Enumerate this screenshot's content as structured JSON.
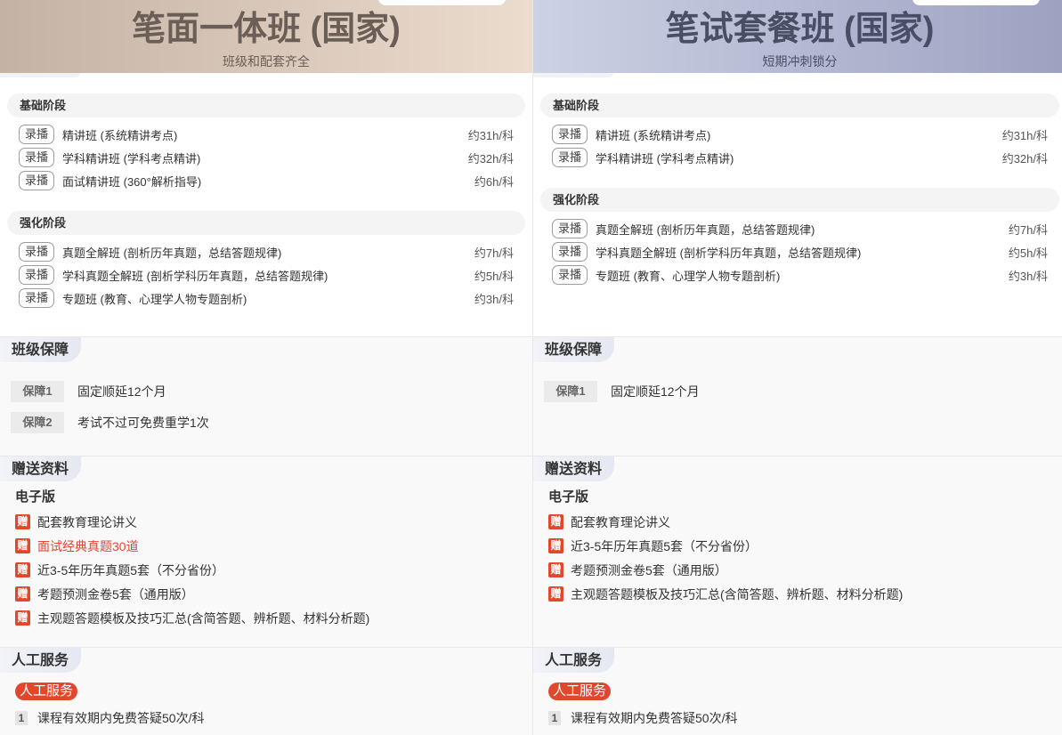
{
  "colors": {
    "accent": "#e0482d",
    "left_header_from": "#c4b3a5",
    "left_header_to": "#ecdccd",
    "left_title": "#6b5e57",
    "right_header_from": "#cdd1e4",
    "right_header_to": "#9da2c1",
    "right_title": "#4a4e65"
  },
  "columns": [
    {
      "title": "笔面一体班 (国家)",
      "subtitle": "班级和配套齐全",
      "stages": [
        {
          "name": "基础阶段",
          "items": [
            {
              "tag": "录播",
              "name": "精讲班 (系统精讲考点)",
              "duration": "约31h/科"
            },
            {
              "tag": "录播",
              "name": "学科精讲班 (学科考点精讲)",
              "duration": "约32h/科"
            },
            {
              "tag": "录播",
              "name": "面试精讲班 (360°解析指导)",
              "duration": "约6h/科"
            }
          ]
        },
        {
          "name": "强化阶段",
          "items": [
            {
              "tag": "录播",
              "name": "真题全解班 (剖析历年真题，总结答题规律)",
              "duration": "约7h/科"
            },
            {
              "tag": "录播",
              "name": "学科真题全解班 (剖析学科历年真题，总结答题规律)",
              "duration": "约5h/科"
            },
            {
              "tag": "录播",
              "name": "专题班 (教育、心理学人物专题剖析)",
              "duration": "约3h/科"
            }
          ]
        }
      ],
      "guarantee": {
        "title": "班级保障",
        "items": [
          {
            "label": "保障1",
            "text": "固定顺延12个月"
          },
          {
            "label": "保障2",
            "text": "考试不过可免费重学1次"
          }
        ]
      },
      "gifts": {
        "title": "赠送资料",
        "category": "电子版",
        "items": [
          {
            "badge": "赠",
            "text": "配套教育理论讲义",
            "emphasized": false
          },
          {
            "badge": "赠",
            "text": "面试经典真题30道",
            "emphasized": true
          },
          {
            "badge": "赠",
            "text": "近3-5年历年真题5套（不分省份）",
            "emphasized": false
          },
          {
            "badge": "赠",
            "text": "考题预测金卷5套（通用版）",
            "emphasized": false
          },
          {
            "badge": "赠",
            "text": "主观题答题模板及技巧汇总(含简答题、辨析题、材料分析题)",
            "emphasized": false
          }
        ]
      },
      "service": {
        "title": "人工服务",
        "badge": "人工服务",
        "items": [
          {
            "index": "1",
            "text": "课程有效期内免费答疑50次/科"
          }
        ]
      }
    },
    {
      "title": "笔试套餐班 (国家)",
      "subtitle": "短期冲刺锁分",
      "stages": [
        {
          "name": "基础阶段",
          "items": [
            {
              "tag": "录播",
              "name": "精讲班 (系统精讲考点)",
              "duration": "约31h/科"
            },
            {
              "tag": "录播",
              "name": "学科精讲班 (学科考点精讲)",
              "duration": "约32h/科"
            }
          ]
        },
        {
          "name": "强化阶段",
          "items": [
            {
              "tag": "录播",
              "name": "真题全解班 (剖析历年真题，总结答题规律)",
              "duration": "约7h/科"
            },
            {
              "tag": "录播",
              "name": "学科真题全解班 (剖析学科历年真题，总结答题规律)",
              "duration": "约5h/科"
            },
            {
              "tag": "录播",
              "name": "专题班 (教育、心理学人物专题剖析)",
              "duration": "约3h/科"
            }
          ]
        }
      ],
      "guarantee": {
        "title": "班级保障",
        "items": [
          {
            "label": "保障1",
            "text": "固定顺延12个月"
          }
        ]
      },
      "gifts": {
        "title": "赠送资料",
        "category": "电子版",
        "items": [
          {
            "badge": "赠",
            "text": "配套教育理论讲义",
            "emphasized": false
          },
          {
            "badge": "赠",
            "text": "近3-5年历年真题5套（不分省份）",
            "emphasized": false
          },
          {
            "badge": "赠",
            "text": "考题预测金卷5套（通用版）",
            "emphasized": false
          },
          {
            "badge": "赠",
            "text": "主观题答题模板及技巧汇总(含简答题、辨析题、材料分析题)",
            "emphasized": false
          }
        ]
      },
      "service": {
        "title": "人工服务",
        "badge": "人工服务",
        "items": [
          {
            "index": "1",
            "text": "课程有效期内免费答疑50次/科"
          }
        ]
      }
    }
  ]
}
